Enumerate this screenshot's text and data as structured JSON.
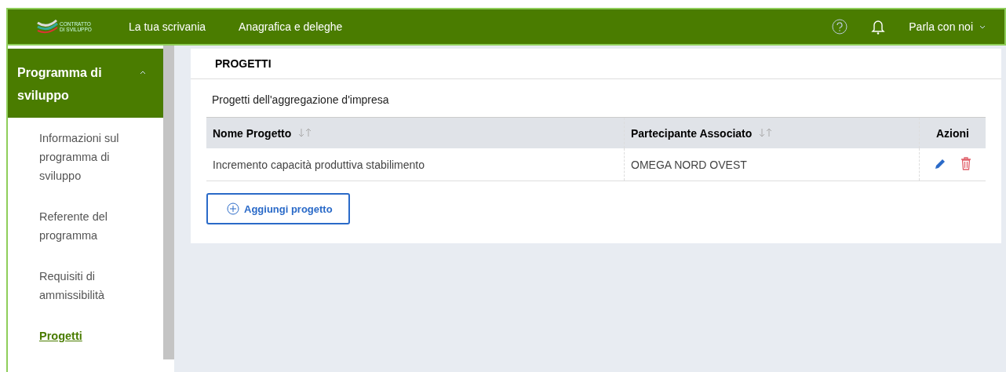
{
  "header": {
    "logo_text": [
      "CONTRATTO",
      "DI SVILUPPO"
    ],
    "nav": [
      "La tua scrivania",
      "Anagrafica e deleghe"
    ],
    "contact": "Parla con noi"
  },
  "sidebar": {
    "section": {
      "title": "Programma di sviluppo",
      "expanded": true
    },
    "items": [
      {
        "label": "Informazioni sul programma di sviluppo",
        "selected": false
      },
      {
        "label": "Referente del programma",
        "selected": false
      },
      {
        "label": "Requisiti di ammissibilità",
        "selected": false
      },
      {
        "label": "Progetti",
        "selected": true
      }
    ]
  },
  "panel": {
    "title": "PROGETTI",
    "subtitle": "Progetti dell'aggregazione d'impresa",
    "table": {
      "columns": [
        {
          "label": "Nome Progetto",
          "sortable": true
        },
        {
          "label": "Partecipante Associato",
          "sortable": true
        },
        {
          "label": "Azioni",
          "sortable": false
        }
      ],
      "rows": [
        {
          "cells": [
            "Incremento capacità produttiva stabilimento",
            "OMEGA NORD OVEST"
          ]
        }
      ]
    },
    "add_button": "Aggiungi progetto"
  }
}
